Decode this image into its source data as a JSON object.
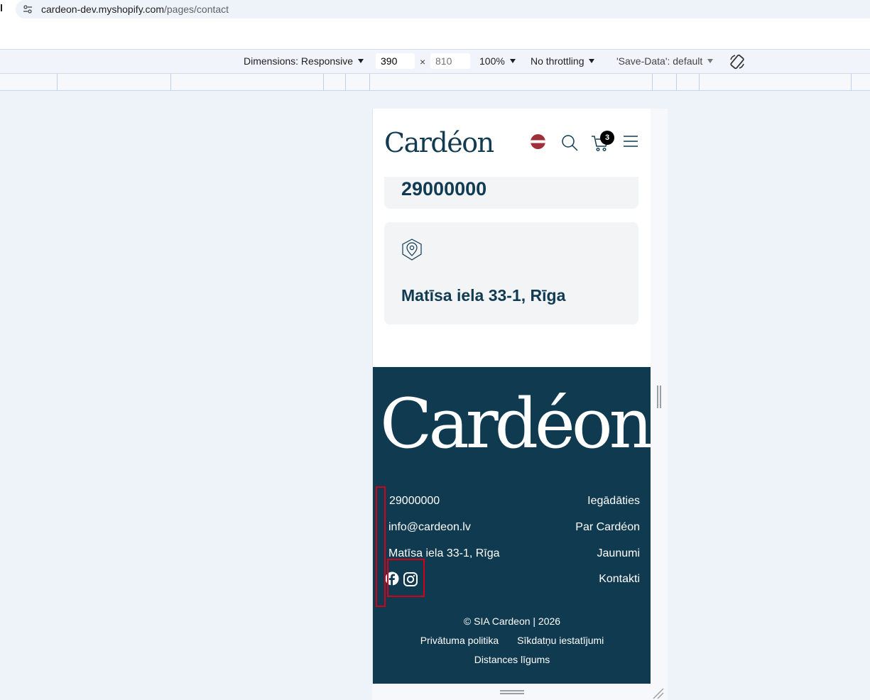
{
  "browser": {
    "url_host": "cardeon-dev.myshopify.com",
    "url_path": "/pages/contact"
  },
  "device_toolbar": {
    "dimensions_label": "Dimensions: Responsive",
    "width_value": "390",
    "height_placeholder": "810",
    "times": "×",
    "zoom_label": "100%",
    "throttling_label": "No throttling",
    "save_data_label": "'Save-Data': default"
  },
  "site": {
    "header": {
      "logo": "Cardéon",
      "cart_count": "3"
    },
    "contact_cards": [
      {
        "value": "29000000"
      },
      {
        "value": "Matīsa iela 33-1, Rīga"
      }
    ],
    "footer": {
      "logo": "Cardéon",
      "contact": {
        "phone": "29000000",
        "email": "info@cardeon.lv",
        "address": "Matīsa iela 33-1, Rīga"
      },
      "nav": [
        "Iegādāties",
        "Par Cardéon",
        "Jaunumi",
        "Kontakti"
      ],
      "copyright": "© SIA Cardeon | 2026",
      "legal": [
        "Privātuma politika",
        "Sīkdatņu iestatījumi",
        "Distances līgums"
      ]
    }
  },
  "colors": {
    "brand_navy": "#103a4f",
    "highlight_red": "#d0021b",
    "flag_red": "#9e3039"
  }
}
